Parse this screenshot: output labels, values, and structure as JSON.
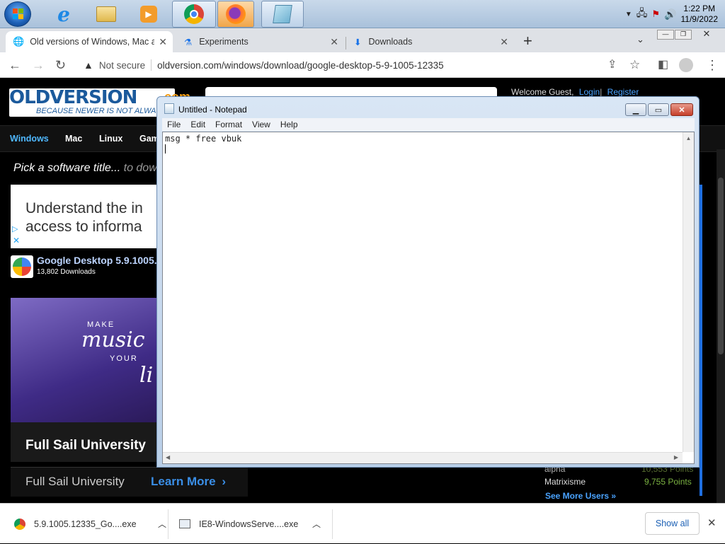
{
  "taskbar": {
    "time": "1:22 PM",
    "date": "11/9/2022"
  },
  "browser": {
    "tabs": [
      {
        "label": "Old versions of Windows, Mac ar"
      },
      {
        "label": "Experiments"
      },
      {
        "label": "Downloads"
      }
    ],
    "security_label": "Not secure",
    "url": "oldversion.com/windows/download/google-desktop-5-9-1005-12335"
  },
  "site": {
    "logo": "OLDVERSION",
    "logo_suffix": ".com",
    "tagline": "BECAUSE NEWER IS NOT ALWAY",
    "welcome": "Welcome Guest,",
    "login": "Login",
    "register": "Register",
    "nav": [
      "Windows",
      "Mac",
      "Linux",
      "Gam"
    ],
    "pick_prefix": "Pick a software title...",
    "pick_suffix": " to dow",
    "ad_line1": "Understand the in",
    "ad_line2": "access to informa",
    "software_title": "Google Desktop 5.9.1005.",
    "downloads": "13,802 Downloads",
    "banner_words": [
      "MAKE",
      "music",
      "YOUR",
      "li"
    ],
    "fullsail_bold": "Full Sail University",
    "fullsail": "Full Sail University",
    "learn_more": "Learn More",
    "users": [
      {
        "name": "alpha",
        "points": "10,553 Points"
      },
      {
        "name": "Matrixisme",
        "points": "9,755 Points"
      }
    ],
    "see_more": "See More Users »"
  },
  "notepad": {
    "title": "Untitled - Notepad",
    "menu": [
      "File",
      "Edit",
      "Format",
      "View",
      "Help"
    ],
    "content": "msg * free vbuk"
  },
  "downloads_bar": {
    "items": [
      {
        "name": "5.9.1005.12335_Go....exe"
      },
      {
        "name": "IE8-WindowsServe....exe"
      }
    ],
    "show_all": "Show all"
  }
}
